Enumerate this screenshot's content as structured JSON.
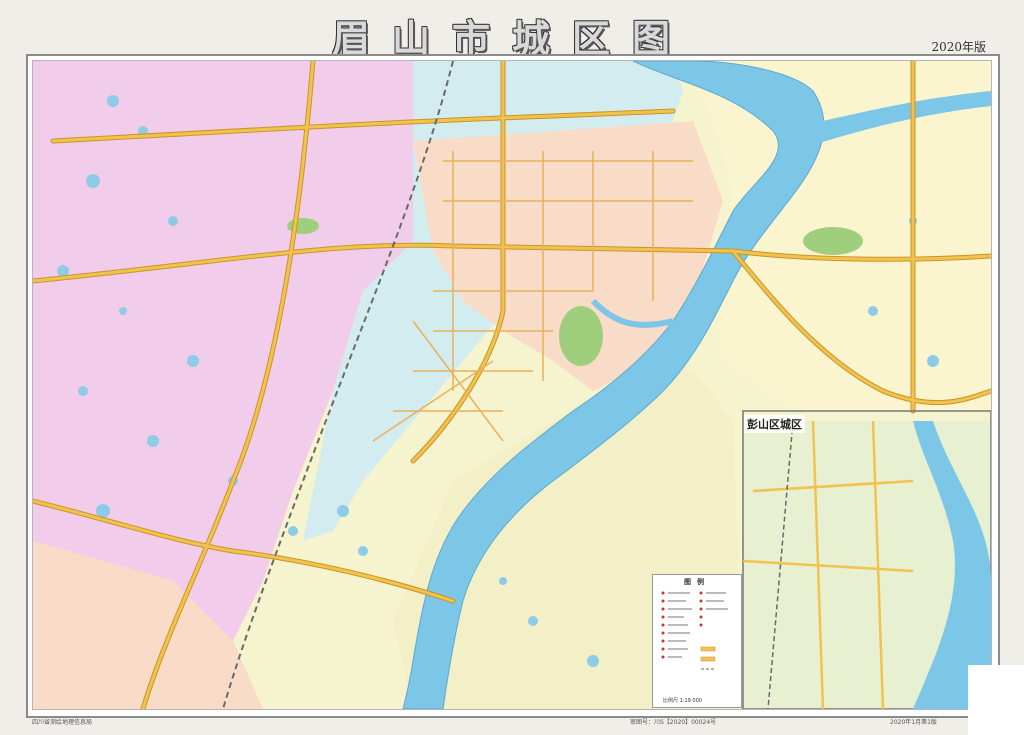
{
  "header": {
    "title": "眉山市城区图",
    "edition": "2020年版"
  },
  "inset": {
    "label": "彭山区城区"
  },
  "legend": {
    "title": "图例",
    "scale": "比例尺 1:19 000"
  },
  "footer": {
    "left_note": "四川省测绘地理信息局",
    "mid_note": "审图号：川S【2020】00024号",
    "right_note": "2020年1月第1版"
  },
  "colors": {
    "district_pink": "#f1cdeb",
    "district_blue": "#d3ecf0",
    "district_peach": "#f9dcc8",
    "district_yellow": "#fbf4c4",
    "district_green": "#e7f0d1",
    "river": "#7cc6e8",
    "road": "#f2c24f",
    "road_edge": "#c99528",
    "park": "#9fcf7d"
  },
  "icons": {
    "ponds": "water-pond-icon",
    "railway": "railway-line-icon"
  }
}
